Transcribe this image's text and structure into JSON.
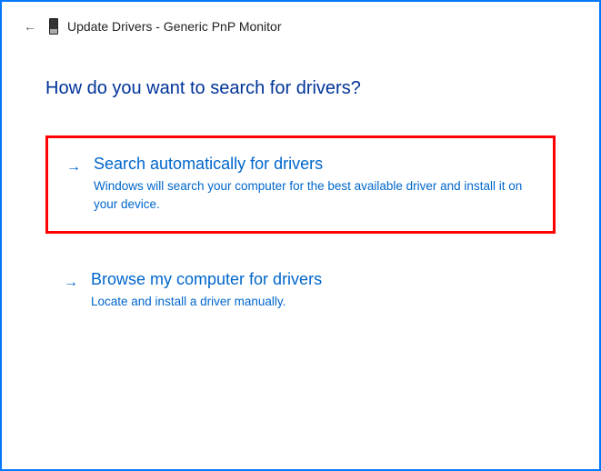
{
  "header": {
    "back_arrow": "←",
    "title": "Update Drivers - Generic PnP Monitor"
  },
  "question": "How do you want to search for drivers?",
  "options": [
    {
      "arrow": "→",
      "title": "Search automatically for drivers",
      "description": "Windows will search your computer for the best available driver and install it on your device."
    },
    {
      "arrow": "→",
      "title": "Browse my computer for drivers",
      "description": "Locate and install a driver manually."
    }
  ]
}
